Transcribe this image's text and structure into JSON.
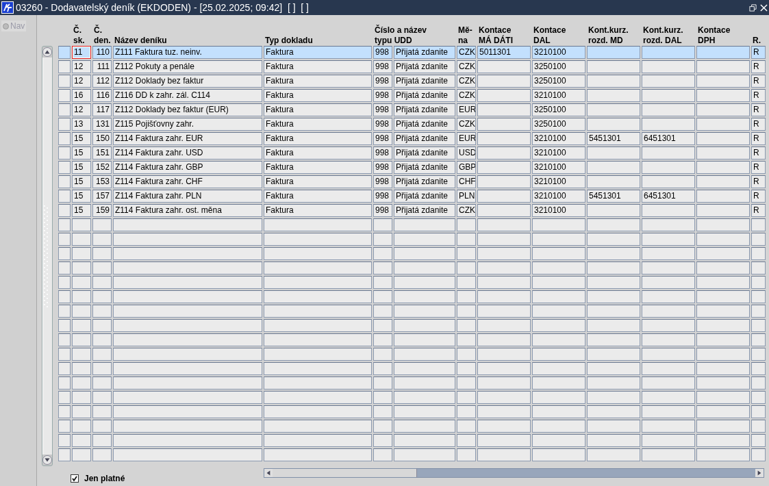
{
  "window": {
    "title": "03260 - Dodavatelský deník (EKDODEN) - [25.02.2025; 09:42]  [ ]  [ ]"
  },
  "sidebar": {
    "items": [
      {
        "label": "Nav",
        "selected": false,
        "disabled": true
      }
    ]
  },
  "table": {
    "columns": [
      {
        "label": "Č.\nsk."
      },
      {
        "label": "Č.\nden."
      },
      {
        "label": "Název deníku"
      },
      {
        "label": "Typ dokladu"
      },
      {
        "label": "Číslo a název\ntypu UDD"
      },
      {},
      {
        "label": "Mě-\nna"
      },
      {
        "label": "Kontace\nMÁ DÁTI"
      },
      {
        "label": "Kontace\nDAL"
      },
      {
        "label": "Kont.kurz.\nrozd. MD"
      },
      {
        "label": "Kont.kurz.\nrozd. DAL"
      },
      {
        "label": "Kontace\nDPH"
      },
      {
        "label": "R."
      }
    ],
    "rows": [
      {
        "selected": true,
        "focused": true,
        "sk": "11",
        "den": "110",
        "name": "Z111 Faktura tuz. neinv.",
        "type": "Faktura",
        "udd_no": "998",
        "udd_name": "Přijatá zdanite",
        "currency": "CZK",
        "md": "5011301",
        "dal": "3210100",
        "r": "R"
      },
      {
        "selected": false,
        "focused": false,
        "sk": "12",
        "den": "111",
        "name": "Z112 Pokuty a penále",
        "type": "Faktura",
        "udd_no": "998",
        "udd_name": "Přijatá zdanite",
        "currency": "CZK",
        "dal": "3250100",
        "r": "R"
      },
      {
        "selected": false,
        "focused": false,
        "sk": "12",
        "den": "112",
        "name": "Z112 Doklady bez faktur",
        "type": "Faktura",
        "udd_no": "998",
        "udd_name": "Přijatá zdanite",
        "currency": "CZK",
        "dal": "3250100",
        "r": "R"
      },
      {
        "selected": false,
        "focused": false,
        "sk": "16",
        "den": "116",
        "name": "Z116 DD k zahr. zál. C114",
        "type": "Faktura",
        "udd_no": "998",
        "udd_name": "Přijatá zdanite",
        "currency": "CZK",
        "dal": "3210100",
        "r": "R"
      },
      {
        "selected": false,
        "focused": false,
        "sk": "12",
        "den": "117",
        "name": "Z112 Doklady bez faktur (EUR)",
        "type": "Faktura",
        "udd_no": "998",
        "udd_name": "Přijatá zdanite",
        "currency": "EUR",
        "dal": "3250100",
        "r": "R"
      },
      {
        "selected": false,
        "focused": false,
        "sk": "13",
        "den": "131",
        "name": "Z115 Pojišťovny zahr.",
        "type": "Faktura",
        "udd_no": "998",
        "udd_name": "Přijatá zdanite",
        "currency": "CZK",
        "dal": "3250100",
        "r": "R"
      },
      {
        "selected": false,
        "focused": false,
        "sk": "15",
        "den": "150",
        "name": "Z114 Faktura zahr. EUR",
        "type": "Faktura",
        "udd_no": "998",
        "udd_name": "Přijatá zdanite",
        "currency": "EUR",
        "dal": "3210100",
        "kurz_md": "5451301",
        "kurz_dal": "6451301",
        "r": "R"
      },
      {
        "selected": false,
        "focused": false,
        "sk": "15",
        "den": "151",
        "name": "Z114 Faktura zahr. USD",
        "type": "Faktura",
        "udd_no": "998",
        "udd_name": "Přijatá zdanite",
        "currency": "USD",
        "dal": "3210100",
        "r": "R"
      },
      {
        "selected": false,
        "focused": false,
        "sk": "15",
        "den": "152",
        "name": "Z114 Faktura zahr. GBP",
        "type": "Faktura",
        "udd_no": "998",
        "udd_name": "Přijatá zdanite",
        "currency": "GBP",
        "dal": "3210100",
        "r": "R"
      },
      {
        "selected": false,
        "focused": false,
        "sk": "15",
        "den": "153",
        "name": "Z114 Faktura zahr. CHF",
        "type": "Faktura",
        "udd_no": "998",
        "udd_name": "Přijatá zdanite",
        "currency": "CHF",
        "dal": "3210100",
        "r": "R"
      },
      {
        "selected": false,
        "focused": false,
        "sk": "15",
        "den": "157",
        "name": "Z114 Faktura zahr. PLN",
        "type": "Faktura",
        "udd_no": "998",
        "udd_name": "Přijatá zdanite",
        "currency": "PLN",
        "dal": "3210100",
        "kurz_md": "5451301",
        "kurz_dal": "6451301",
        "r": "R"
      },
      {
        "selected": false,
        "focused": false,
        "sk": "15",
        "den": "159",
        "name": "Z114 Faktura zahr. ost. měna",
        "type": "Faktura",
        "udd_no": "998",
        "udd_name": "Přijatá zdanite",
        "currency": "CZK",
        "dal": "3210100",
        "r": "R"
      }
    ]
  },
  "filter": {
    "label": "Jen platné",
    "checked": true
  }
}
